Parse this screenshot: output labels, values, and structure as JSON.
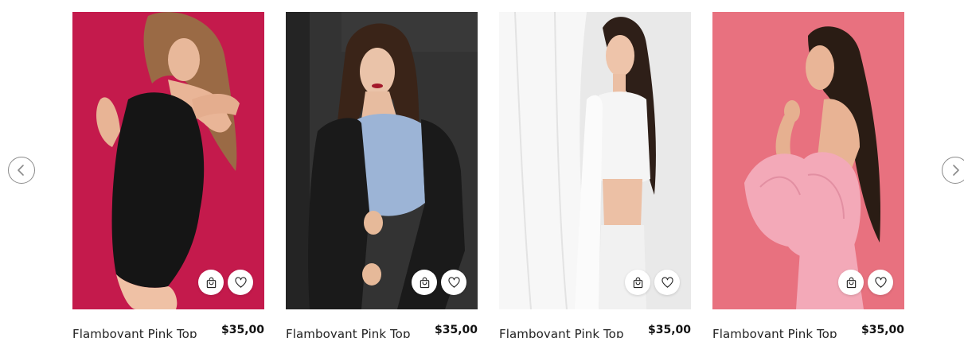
{
  "carousel": {
    "prev_icon": "chevron-left-icon",
    "next_icon": "chevron-right-icon"
  },
  "products": [
    {
      "name": "Flamboyant Pink Top",
      "price": "$35,00",
      "background": "#c41a4c",
      "outfit": "#151515",
      "hair": "#9a6a45"
    },
    {
      "name": "Flamboyant Pink Top",
      "price": "$35,00",
      "background": "#333333",
      "outfit": "#1a1a1a",
      "hair": "#3a2418"
    },
    {
      "name": "Flamboyant Pink Top",
      "price": "$35,00",
      "background": "#e9e9e9",
      "outfit": "#f5f5f5",
      "hair": "#2e1f18"
    },
    {
      "name": "Flamboyant Pink Top",
      "price": "$35,00",
      "background": "#e8717f",
      "outfit": "#f3a9b8",
      "hair": "#2a1c14"
    }
  ],
  "actions": {
    "cart_icon": "shopping-bag-icon",
    "wishlist_icon": "heart-icon"
  }
}
